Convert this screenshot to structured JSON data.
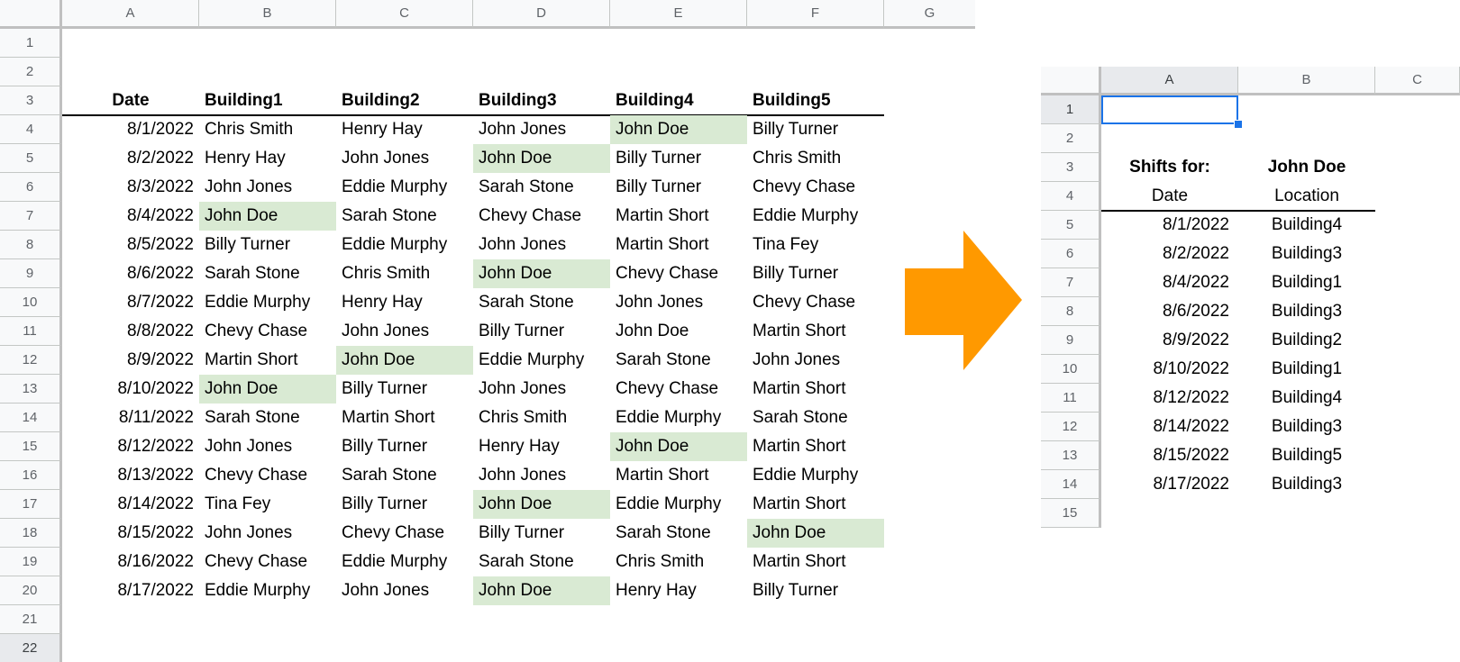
{
  "left_sheet": {
    "columns": [
      "A",
      "B",
      "C",
      "D",
      "E",
      "F",
      "G"
    ],
    "rows": [
      "1",
      "2",
      "3",
      "4",
      "5",
      "6",
      "7",
      "8",
      "9",
      "10",
      "11",
      "12",
      "13",
      "14",
      "15",
      "16",
      "17",
      "18",
      "19",
      "20",
      "21",
      "22"
    ],
    "active_row": "22",
    "header": [
      "Date",
      "Building1",
      "Building2",
      "Building3",
      "Building4",
      "Building5"
    ],
    "data": [
      [
        "8/1/2022",
        "Chris Smith",
        "Henry Hay",
        "John Jones",
        "John Doe",
        "Billy Turner"
      ],
      [
        "8/2/2022",
        "Henry Hay",
        "John Jones",
        "John Doe",
        "Billy Turner",
        "Chris Smith"
      ],
      [
        "8/3/2022",
        "John Jones",
        "Eddie Murphy",
        "Sarah Stone",
        "Billy Turner",
        "Chevy Chase"
      ],
      [
        "8/4/2022",
        "John Doe",
        "Sarah Stone",
        "Chevy Chase",
        "Martin Short",
        "Eddie Murphy"
      ],
      [
        "8/5/2022",
        "Billy Turner",
        "Eddie Murphy",
        "John Jones",
        "Martin Short",
        "Tina Fey"
      ],
      [
        "8/6/2022",
        "Sarah Stone",
        "Chris Smith",
        "John Doe",
        "Chevy Chase",
        "Billy Turner"
      ],
      [
        "8/7/2022",
        "Eddie Murphy",
        "Henry Hay",
        "Sarah Stone",
        "John Jones",
        "Chevy Chase"
      ],
      [
        "8/8/2022",
        "Chevy Chase",
        "John Jones",
        "Billy Turner",
        "John Doe",
        "Martin Short"
      ],
      [
        "8/9/2022",
        "Martin Short",
        "John Doe",
        "Eddie Murphy",
        "Sarah Stone",
        "John Jones"
      ],
      [
        "8/10/2022",
        "John Doe",
        "Billy Turner",
        "John Jones",
        "Chevy Chase",
        "Martin Short"
      ],
      [
        "8/11/2022",
        "Sarah Stone",
        "Martin Short",
        "Chris Smith",
        "Eddie Murphy",
        "Sarah Stone"
      ],
      [
        "8/12/2022",
        "John Jones",
        "Billy Turner",
        "Henry Hay",
        "John Doe",
        "Martin Short"
      ],
      [
        "8/13/2022",
        "Chevy Chase",
        "Sarah Stone",
        "John Jones",
        "Martin Short",
        "Eddie Murphy"
      ],
      [
        "8/14/2022",
        "Tina Fey",
        "Billy Turner",
        "John Doe",
        "Eddie Murphy",
        "Martin Short"
      ],
      [
        "8/15/2022",
        "John Jones",
        "Chevy Chase",
        "Billy Turner",
        "Sarah Stone",
        "John Doe"
      ],
      [
        "8/16/2022",
        "Chevy Chase",
        "Eddie Murphy",
        "Sarah Stone",
        "Chris Smith",
        "Martin Short"
      ],
      [
        "8/17/2022",
        "Eddie Murphy",
        "John Jones",
        "John Doe",
        "Henry Hay",
        "Billy Turner"
      ]
    ],
    "highlights": [
      [
        0,
        4
      ],
      [
        1,
        3
      ],
      [
        3,
        1
      ],
      [
        5,
        3
      ],
      [
        8,
        2
      ],
      [
        9,
        1
      ],
      [
        11,
        4
      ],
      [
        13,
        3
      ],
      [
        14,
        5
      ],
      [
        16,
        3
      ]
    ],
    "highlight_color": "#d9ead3"
  },
  "arrow": {
    "color": "#ff9900",
    "direction": "right"
  },
  "right_sheet": {
    "columns": [
      "A",
      "B",
      "C"
    ],
    "rows": [
      "1",
      "2",
      "3",
      "4",
      "5",
      "6",
      "7",
      "8",
      "9",
      "10",
      "11",
      "12",
      "13",
      "14",
      "15"
    ],
    "active_row": "1",
    "active_column": "A",
    "selected_cell": "A1",
    "title_label": "Shifts for:",
    "title_value": "John Doe",
    "header": [
      "Date",
      "Location"
    ],
    "data": [
      [
        "8/1/2022",
        "Building4"
      ],
      [
        "8/2/2022",
        "Building3"
      ],
      [
        "8/4/2022",
        "Building1"
      ],
      [
        "8/6/2022",
        "Building3"
      ],
      [
        "8/9/2022",
        "Building2"
      ],
      [
        "8/10/2022",
        "Building1"
      ],
      [
        "8/12/2022",
        "Building4"
      ],
      [
        "8/14/2022",
        "Building3"
      ],
      [
        "8/15/2022",
        "Building5"
      ],
      [
        "8/17/2022",
        "Building3"
      ]
    ],
    "selection_color": "#1a73e8"
  }
}
